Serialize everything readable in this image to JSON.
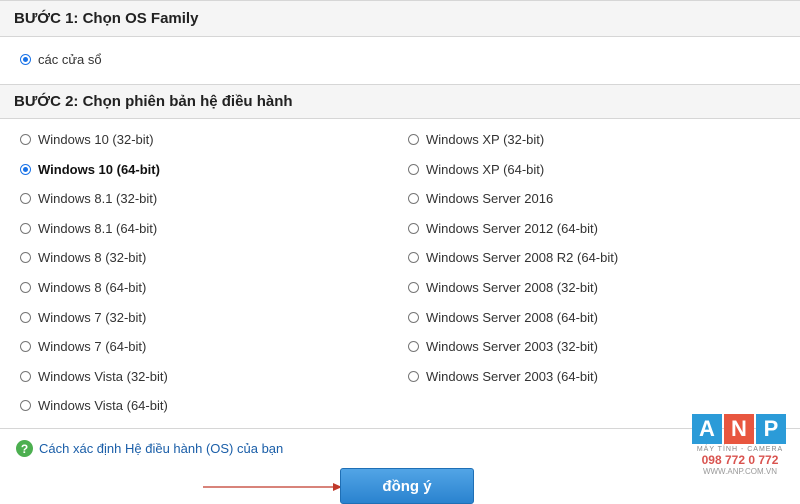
{
  "step1": {
    "title": "BƯỚC 1: Chọn OS Family",
    "option": {
      "label": "các cửa sổ",
      "checked": true
    }
  },
  "step2": {
    "title": "BƯỚC 2: Chọn phiên bản hệ điều hành",
    "left_options": [
      {
        "label": "Windows 10 (32-bit)",
        "checked": false
      },
      {
        "label": "Windows 10 (64-bit)",
        "checked": true
      },
      {
        "label": "Windows 8.1 (32-bit)",
        "checked": false
      },
      {
        "label": "Windows 8.1 (64-bit)",
        "checked": false
      },
      {
        "label": "Windows 8 (32-bit)",
        "checked": false
      },
      {
        "label": "Windows 8 (64-bit)",
        "checked": false
      },
      {
        "label": "Windows 7 (32-bit)",
        "checked": false
      },
      {
        "label": "Windows 7 (64-bit)",
        "checked": false
      },
      {
        "label": "Windows Vista (32-bit)",
        "checked": false
      },
      {
        "label": "Windows Vista (64-bit)",
        "checked": false
      }
    ],
    "right_options": [
      {
        "label": "Windows XP (32-bit)",
        "checked": false
      },
      {
        "label": "Windows XP (64-bit)",
        "checked": false
      },
      {
        "label": "Windows Server 2016",
        "checked": false
      },
      {
        "label": "Windows Server 2012 (64-bit)",
        "checked": false
      },
      {
        "label": "Windows Server 2008 R2 (64-bit)",
        "checked": false
      },
      {
        "label": "Windows Server 2008 (32-bit)",
        "checked": false
      },
      {
        "label": "Windows Server 2008 (64-bit)",
        "checked": false
      },
      {
        "label": "Windows Server 2003 (32-bit)",
        "checked": false
      },
      {
        "label": "Windows Server 2003 (64-bit)",
        "checked": false
      }
    ]
  },
  "help": {
    "icon": "question-icon",
    "glyph": "?",
    "label": "Cách xác định Hệ điều hành (OS) của bạn"
  },
  "submit": {
    "label": "đồng ý"
  },
  "watermark": {
    "letters": [
      "A",
      "N",
      "P"
    ],
    "colors": [
      "#2b9bd8",
      "#e8563f",
      "#2b9bd8"
    ],
    "subtitle": "MÁY TÍNH - CAMERA",
    "phone": "098 772 0 772",
    "website": "WWW.ANP.COM.VN"
  },
  "colors": {
    "accent": "#1a73e8",
    "button": "#2a83cf",
    "arrow": "#c0392b",
    "help_icon": "#4caf50"
  }
}
